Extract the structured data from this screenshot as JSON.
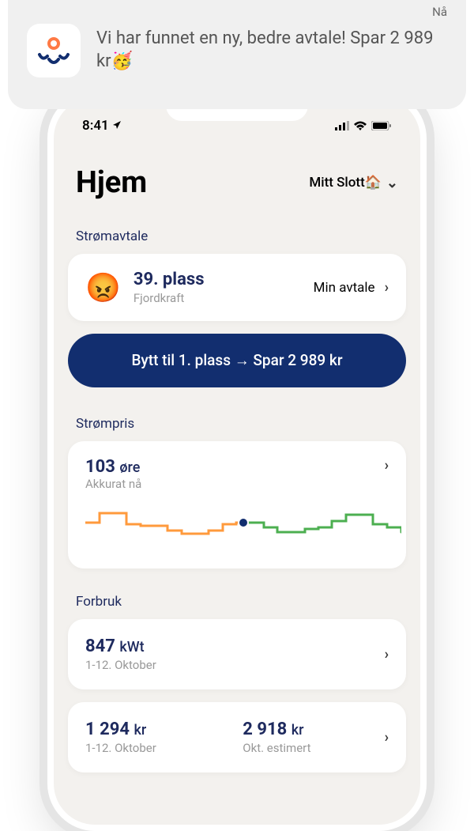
{
  "notification": {
    "time_label": "Nå",
    "message": "Vi har funnet en ny, bedre avtale! Spar 2 989 kr🥳"
  },
  "status_bar": {
    "time": "8:41"
  },
  "header": {
    "title": "Hjem",
    "location": "Mitt Slott🏠"
  },
  "sections": {
    "contract_label": "Strømavtale",
    "price_label": "Strømpris",
    "usage_label": "Forbruk"
  },
  "contract_card": {
    "rank": "39. plass",
    "provider": "Fjordkraft",
    "action_label": "Min avtale"
  },
  "cta_button": {
    "label": "Bytt til 1. plass → Spar 2 989 kr"
  },
  "price_card": {
    "value": "103",
    "unit": "øre",
    "when": "Akkurat nå"
  },
  "usage_card": {
    "value": "847",
    "unit": "kWt",
    "period": "1-12. Oktober"
  },
  "cost_card": {
    "left_value": "1 294",
    "left_unit": "kr",
    "left_period": "1-12. Oktober",
    "right_value": "2 918",
    "right_unit": "kr",
    "right_period": "Okt. estimert"
  },
  "chart_data": {
    "type": "line",
    "title": "Strømpris",
    "ylabel": "øre",
    "x": [
      0,
      1,
      2,
      3,
      4,
      5,
      6,
      7,
      8,
      9,
      10,
      11,
      12,
      13,
      14,
      15,
      16,
      17,
      18,
      19,
      20,
      21,
      22,
      23
    ],
    "values": [
      105,
      120,
      120,
      100,
      98,
      98,
      90,
      85,
      85,
      90,
      100,
      103,
      103,
      95,
      88,
      88,
      92,
      95,
      105,
      115,
      115,
      100,
      95,
      88
    ],
    "current_index": 11,
    "ylim": [
      60,
      140
    ]
  }
}
